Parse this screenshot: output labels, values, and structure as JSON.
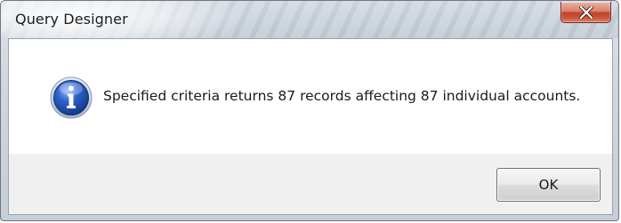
{
  "window": {
    "title": "Query Designer"
  },
  "title_bar": {
    "close_icon": "close-x-icon",
    "close_color": "#c9452c"
  },
  "dialog": {
    "icon": "information-icon",
    "icon_color": "#1d4fa8",
    "message": "Specified criteria returns 87 records affecting 87 individual accounts."
  },
  "buttons": {
    "ok_label": "OK"
  }
}
